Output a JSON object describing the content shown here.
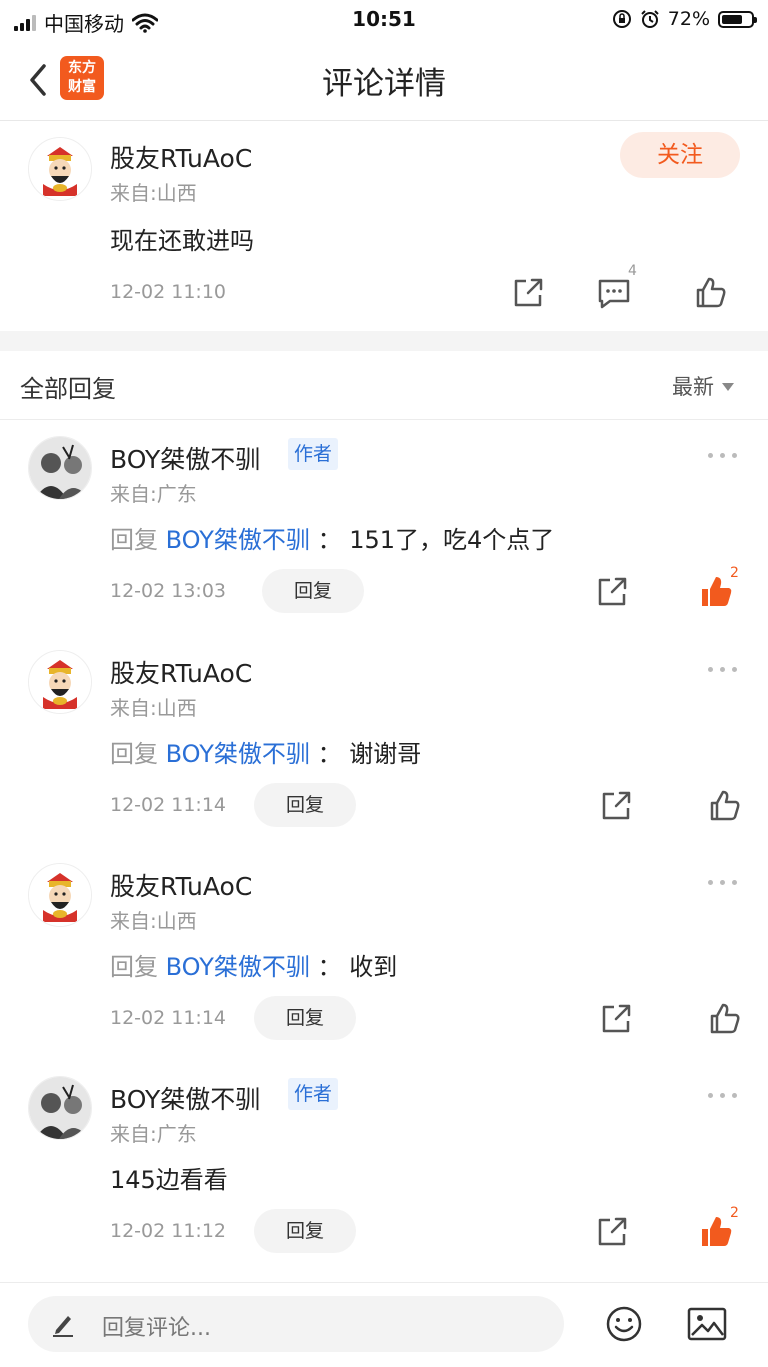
{
  "status_bar": {
    "carrier": "中国移动",
    "time": "10:51",
    "battery": "72%",
    "battery_level": 0.72
  },
  "nav": {
    "title": "评论详情",
    "logo_line1": "东方",
    "logo_line2": "财富"
  },
  "post": {
    "author": "股友RTuAoC",
    "location": "来自:山西",
    "content": "现在还敢进吗",
    "time": "12-02 11:10",
    "follow_label": "关注",
    "comment_count": "4"
  },
  "section": {
    "label": "全部回复",
    "sort": "最新"
  },
  "replies": [
    {
      "author": "BOY桀傲不驯",
      "author_tag": "作者",
      "location": "来自:广东",
      "prefix": "回复",
      "target": "BOY桀傲不驯",
      "separator": "：",
      "text": "151了，吃4个点了",
      "time": "12-02 13:03",
      "reply_label": "回复",
      "likes": "2",
      "liked": true
    },
    {
      "author": "股友RTuAoC",
      "location": "来自:山西",
      "prefix": "回复",
      "target": "BOY桀傲不驯",
      "separator": "：",
      "text": "谢谢哥",
      "time": "12-02 11:14",
      "reply_label": "回复",
      "liked": false
    },
    {
      "author": "股友RTuAoC",
      "location": "来自:山西",
      "prefix": "回复",
      "target": "BOY桀傲不驯",
      "separator": "：",
      "text": "收到",
      "time": "12-02 11:14",
      "reply_label": "回复",
      "liked": false
    },
    {
      "author": "BOY桀傲不驯",
      "author_tag": "作者",
      "location": "来自:广东",
      "text": "145边看看",
      "time": "12-02 11:12",
      "reply_label": "回复",
      "likes": "2",
      "liked": true
    }
  ],
  "bottom": {
    "placeholder": "回复评论..."
  },
  "colors": {
    "brand": "#f25a1e",
    "link": "#2a6fd6"
  },
  "icons": [
    "signal-icon",
    "wifi-icon",
    "orientation-lock-icon",
    "alarm-icon",
    "battery-icon",
    "back-icon",
    "share-icon",
    "comment-icon",
    "like-icon",
    "more-icon",
    "pen-icon",
    "emoji-icon",
    "image-icon"
  ]
}
